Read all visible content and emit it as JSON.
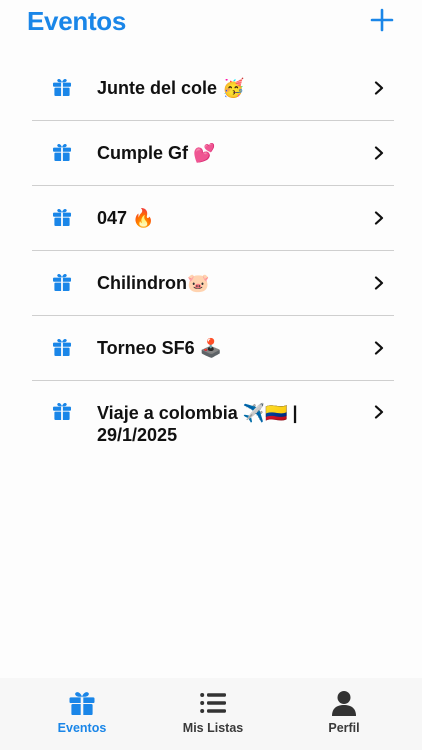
{
  "header": {
    "title": "Eventos",
    "add_icon": "plus-icon"
  },
  "events": [
    {
      "label": "Junte del cole 🥳",
      "icon": "gift-icon"
    },
    {
      "label": "Cumple Gf 💕",
      "icon": "gift-icon"
    },
    {
      "label": "047 🔥",
      "icon": "gift-icon"
    },
    {
      "label": "Chilindron🐷",
      "icon": "gift-icon"
    },
    {
      "label": "Torneo SF6 🕹️",
      "icon": "gift-icon"
    },
    {
      "label": "Viaje a colombia ✈️🇨🇴 | 29/1/2025",
      "icon": "gift-icon"
    }
  ],
  "tabbar": {
    "tabs": [
      {
        "label": "Eventos",
        "icon": "gift-icon",
        "active": true
      },
      {
        "label": "Mis Listas",
        "icon": "list-icon",
        "active": false
      },
      {
        "label": "Perfil",
        "icon": "person-icon",
        "active": false
      }
    ]
  },
  "colors": {
    "accent": "#1a86e8",
    "text": "#111111",
    "divider": "#cfcfcf",
    "tab_inactive": "#3a3a3a"
  }
}
